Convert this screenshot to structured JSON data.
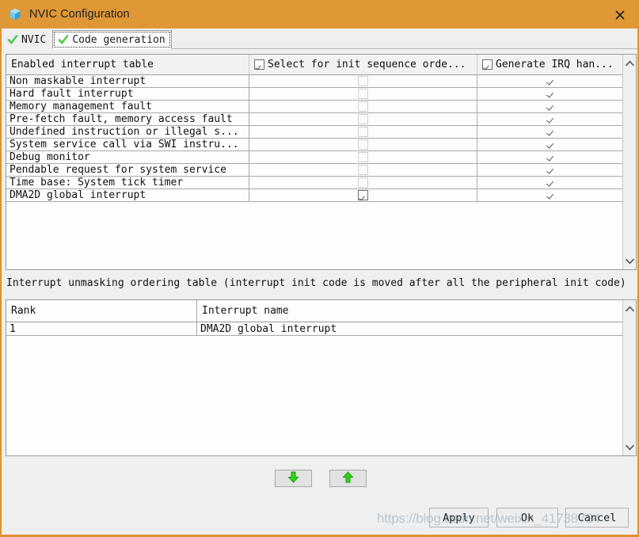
{
  "window": {
    "title": "NVIC Configuration",
    "icon": "cube-icon",
    "close_label": "×",
    "titlebar_color": "#df9836",
    "border_color": "#e0912f"
  },
  "tabs": [
    {
      "label": "NVIC",
      "icon": "green-check-icon",
      "active": false
    },
    {
      "label": "Code generation",
      "icon": "green-check-icon",
      "active": true
    }
  ],
  "enabled_table": {
    "columns": [
      {
        "label": "Enabled interrupt table",
        "has_checkbox": false
      },
      {
        "label": "Select for init sequence orde...",
        "has_checkbox": true,
        "checked": true
      },
      {
        "label": "Generate IRQ han...",
        "has_checkbox": true,
        "checked": true
      }
    ],
    "rows": [
      {
        "name": "Non maskable interrupt",
        "select_for_init": false,
        "select_enabled": false,
        "generate_irq": true
      },
      {
        "name": "Hard fault interrupt",
        "select_for_init": false,
        "select_enabled": false,
        "generate_irq": true
      },
      {
        "name": "Memory management fault",
        "select_for_init": false,
        "select_enabled": false,
        "generate_irq": true
      },
      {
        "name": "Pre-fetch fault, memory access fault",
        "select_for_init": false,
        "select_enabled": false,
        "generate_irq": true
      },
      {
        "name": "Undefined instruction or illegal s...",
        "select_for_init": false,
        "select_enabled": false,
        "generate_irq": true
      },
      {
        "name": "System service call via SWI instru...",
        "select_for_init": false,
        "select_enabled": false,
        "generate_irq": true
      },
      {
        "name": "Debug monitor",
        "select_for_init": false,
        "select_enabled": false,
        "generate_irq": true
      },
      {
        "name": "Pendable request for system service",
        "select_for_init": false,
        "select_enabled": false,
        "generate_irq": true
      },
      {
        "name": "Time base: System tick timer",
        "select_for_init": false,
        "select_enabled": false,
        "generate_irq": true
      },
      {
        "name": "DMA2D global interrupt",
        "select_for_init": true,
        "select_enabled": true,
        "generate_irq": true
      }
    ]
  },
  "ordering": {
    "caption": "Interrupt unmasking ordering table (interrupt init code is moved after all the peripheral init code)",
    "columns": [
      "Rank",
      "Interrupt name"
    ],
    "rows": [
      {
        "rank": "1",
        "name": "DMA2D global interrupt"
      }
    ]
  },
  "move_buttons": {
    "down_label": "move-down",
    "up_label": "move-up",
    "arrow_color": "#35cf17"
  },
  "dialog_buttons": {
    "apply": "Apply",
    "ok": "Ok",
    "cancel": "Cancel"
  },
  "watermark": "https://blog.csdn.net/weixin_41738734"
}
